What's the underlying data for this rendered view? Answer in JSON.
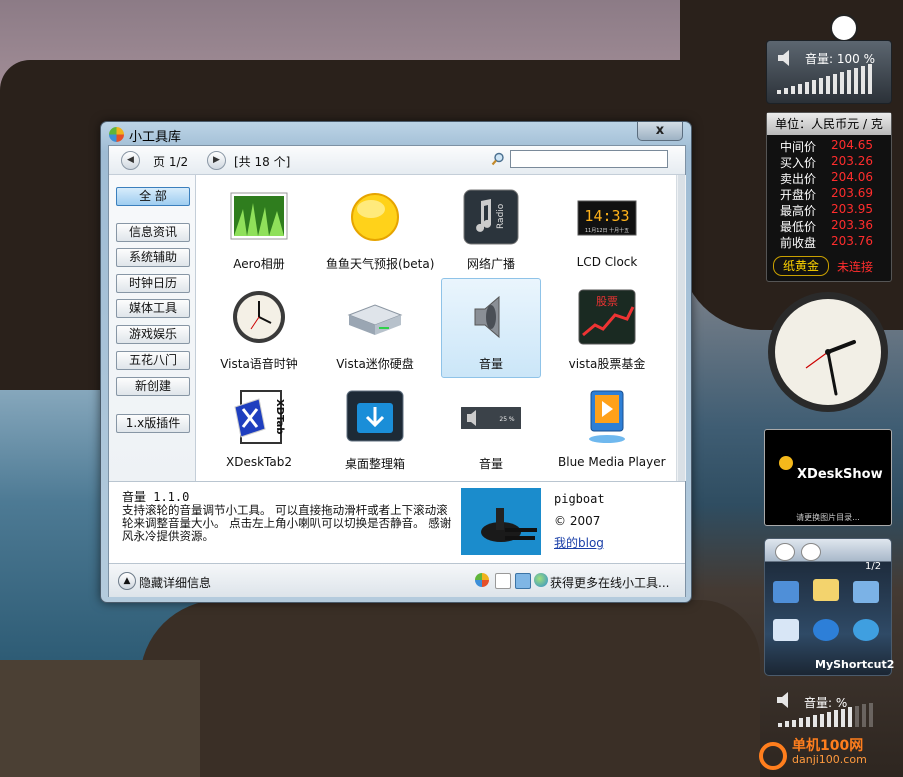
{
  "window": {
    "title": "小工具库",
    "close_label": "x"
  },
  "toolbar": {
    "prev_icon": "chevron-left-icon",
    "next_icon": "chevron-right-icon",
    "page_label": "页 1/2",
    "count_label": "[共 18 个]",
    "search_placeholder": ""
  },
  "categories": [
    {
      "label": "全  部",
      "active": true
    },
    {
      "label": "信息资讯"
    },
    {
      "label": "系统辅助"
    },
    {
      "label": "时钟日历"
    },
    {
      "label": "媒体工具"
    },
    {
      "label": "游戏娱乐"
    },
    {
      "label": "五花八门"
    },
    {
      "label": "新创建"
    },
    {
      "label": "1.x版插件"
    }
  ],
  "gadgets": [
    {
      "label": "Aero相册",
      "icon": "photo-album-icon"
    },
    {
      "label": "鱼鱼天气预报(beta)",
      "icon": "sun-icon"
    },
    {
      "label": "网络广播",
      "icon": "radio-icon"
    },
    {
      "label": "LCD Clock",
      "icon": "lcd-clock-icon",
      "lcd_time": "14:33",
      "lcd_date": "11月12日 十月十五"
    },
    {
      "label": "Vista语音时钟",
      "icon": "analog-clock-icon"
    },
    {
      "label": "Vista迷你硬盘",
      "icon": "hard-disk-icon"
    },
    {
      "label": "音量",
      "icon": "speaker-icon",
      "selected": true
    },
    {
      "label": "vista股票基金",
      "icon": "stock-chart-icon",
      "thumb_text": "股票"
    },
    {
      "label": "XDeskTab2",
      "icon": "xdesktab-icon",
      "thumb_text": "XDTab"
    },
    {
      "label": "桌面整理箱",
      "icon": "desktop-box-icon"
    },
    {
      "label": "音量",
      "icon": "volume-bar-icon",
      "thumb_text": "25 %"
    },
    {
      "label": "Blue Media Player",
      "icon": "media-player-icon"
    }
  ],
  "details": {
    "name": "音量 1.1.0",
    "description": "支持滚轮的音量调节小工具。  可以直接拖动滑杆或者上下滚动滚轮来调整音量大小。  点击左上角小喇叭可以切换是否静音。  感谢风永冷提供资源。",
    "author": "pigboat",
    "copyright": "© 2007",
    "link": "我的blog"
  },
  "bottom": {
    "hide_label": "隐藏详细信息",
    "more_label": "获得更多在线小工具..."
  },
  "volume_gadget": {
    "label": "音量: 100 %",
    "level": 1.0
  },
  "gold_gadget": {
    "header": "单位：人民币元 / 克",
    "rows": [
      {
        "label": "中间价",
        "value": "204.65"
      },
      {
        "label": "买入价",
        "value": "203.26"
      },
      {
        "label": "卖出价",
        "value": "204.06"
      },
      {
        "label": "开盘价",
        "value": "203.69"
      },
      {
        "label": "最高价",
        "value": "203.95"
      },
      {
        "label": "最低价",
        "value": "203.36"
      },
      {
        "label": "前收盘",
        "value": "203.76"
      }
    ],
    "footer_button": "纸黄金",
    "status": "未连接",
    "value_color": "#ff2d2d"
  },
  "xdeskshow": {
    "title": "XDeskShow",
    "subtitle": "请更换图片目录..."
  },
  "myshortcut": {
    "page": "1/2",
    "label": "MyShortcut2"
  },
  "volume_gadget_2": {
    "label": "音量:  %",
    "level": 0.8
  },
  "watermark": {
    "text": "单机100网",
    "sub": "danji100.com"
  }
}
